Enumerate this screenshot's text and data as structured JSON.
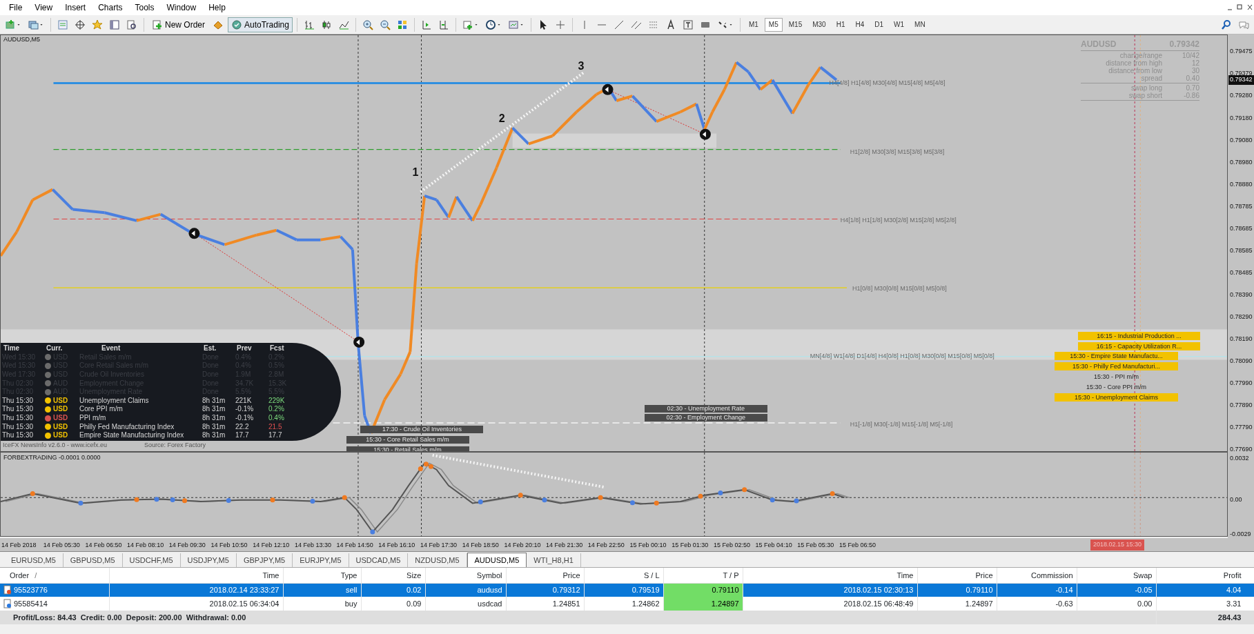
{
  "menu": [
    "File",
    "View",
    "Insert",
    "Charts",
    "Tools",
    "Window",
    "Help"
  ],
  "toolbar": {
    "buttons": [
      {
        "label": "New Order",
        "kind": "order"
      },
      {
        "label": "AutoTrading",
        "kind": "auto",
        "on": true
      }
    ],
    "timeframes": [
      {
        "label": "M1",
        "selected": false
      },
      {
        "label": "M5",
        "selected": true
      },
      {
        "label": "M15",
        "selected": false
      },
      {
        "label": "M30",
        "selected": false
      },
      {
        "label": "H1",
        "selected": false
      },
      {
        "label": "H4",
        "selected": false
      },
      {
        "label": "D1",
        "selected": false
      },
      {
        "label": "W1",
        "selected": false
      },
      {
        "label": "MN",
        "selected": false
      }
    ]
  },
  "chart": {
    "title": "AUDUSD,M5",
    "wave_marks": [
      "1",
      "2",
      "3"
    ],
    "level_labels": [
      "H4[4/8] H1[4/8] M30[4/8] M15[4/8] M5[4/8]",
      "H1[2/8] M30[3/8] M15[3/8] M5[3/8]",
      "H4[1/8] H1[1/8] M30[2/8] M15[2/8] M5[2/8]",
      "H1[0/8] M30[0/8] M15[0/8] M5[0/8]",
      "MN[4/8] W1[4/8] D1[4/8] H4[0/8] H1[0/8] M30[0/8] M15[0/8] M5[0/8]",
      "H1[-1/8] M30[-1/8] M15[-1/8] M5[-1/8]"
    ],
    "event_labels": [
      "17:30 - Crude Oil Inventories",
      "15:30 - Core Retail Sales m/m",
      "15:30 - Retail Sales m/m",
      "02:30 - Unemployment Rate",
      "02:30 - Employment Change"
    ],
    "news_panel": {
      "columns": [
        "Time",
        "Curr.",
        "Event",
        "Est.",
        "Prev",
        "Fcst"
      ],
      "rows": [
        {
          "time": "Wed 15:30",
          "currency": "USD",
          "event": "Retail Sales m/m",
          "est": "Done",
          "prev": "0.4%",
          "forecast": {
            "value": "0.2%",
            "kind": "flat"
          },
          "past": true,
          "color": "#6b6b6b"
        },
        {
          "time": "Wed 15:30",
          "currency": "USD",
          "event": "Core Retail Sales m/m",
          "est": "Done",
          "prev": "0.4%",
          "forecast": {
            "value": "0.5%",
            "kind": "flat"
          },
          "past": true,
          "color": "#6b6b6b"
        },
        {
          "time": "Wed 17:30",
          "currency": "USD",
          "event": "Crude Oil Inventories",
          "est": "Done",
          "prev": "1.9M",
          "forecast": {
            "value": "2.8M",
            "kind": "flat"
          },
          "past": true,
          "color": "#6b6b6b"
        },
        {
          "time": "Thu 02:30",
          "currency": "AUD",
          "event": "Employment Change",
          "est": "Done",
          "prev": "34.7K",
          "forecast": {
            "value": "15.3K",
            "kind": "flat"
          },
          "past": true,
          "color": "#6b6b6b"
        },
        {
          "time": "Thu 02:30",
          "currency": "AUD",
          "event": "Unemployment Rate",
          "est": "Done",
          "prev": "5.5%",
          "forecast": {
            "value": "5.5%",
            "kind": "flat"
          },
          "past": true,
          "color": "#6b6b6b"
        },
        {
          "time": "Thu 15:30",
          "currency": "USD",
          "event": "Unemployment Claims",
          "est": "8h 31m",
          "prev": "221K",
          "forecast": {
            "value": "229K",
            "kind": "up"
          },
          "past": false,
          "color": "#f2c200"
        },
        {
          "time": "Thu 15:30",
          "currency": "USD",
          "event": "Core PPI m/m",
          "est": "8h 31m",
          "prev": "-0.1%",
          "forecast": {
            "value": "0.2%",
            "kind": "up"
          },
          "past": false,
          "color": "#f2c200"
        },
        {
          "time": "Thu 15:30",
          "currency": "USD",
          "event": "PPI m/m",
          "est": "8h 31m",
          "prev": "-0.1%",
          "forecast": {
            "value": "0.4%",
            "kind": "up"
          },
          "past": false,
          "color": "#d9534f"
        },
        {
          "time": "Thu 15:30",
          "currency": "USD",
          "event": "Philly Fed Manufacturing Index",
          "est": "8h 31m",
          "prev": "22.2",
          "forecast": {
            "value": "21.5",
            "kind": "down"
          },
          "past": false,
          "color": "#f2c200"
        },
        {
          "time": "Thu 15:30",
          "currency": "USD",
          "event": "Empire State Manufacturing Index",
          "est": "8h 31m",
          "prev": "17.7",
          "forecast": {
            "value": "17.7",
            "kind": "flat"
          },
          "past": false,
          "color": "#f2c200"
        }
      ],
      "footer": [
        "IceFX NewsInfo v2.6.0  -  www.icefx.eu",
        "Source: Forex Factory"
      ]
    },
    "info_panel": {
      "symbol": "AUDUSD",
      "price": "0.79342",
      "groups": [
        [
          {
            "label": "change/range",
            "value": "10/42"
          },
          {
            "label": "distance from high",
            "value": "12"
          },
          {
            "label": "distance from low",
            "value": "30"
          },
          {
            "label": "spread",
            "value": "0.40"
          }
        ],
        [
          {
            "label": "swap long",
            "value": "0.70"
          },
          {
            "label": "swap short",
            "value": "-0.86"
          }
        ]
      ]
    },
    "upcoming": [
      {
        "text": "16:15 - Industrial Production ...",
        "highlighted": true
      },
      {
        "text": "16:15 - Capacity Utilization R...",
        "highlighted": true
      },
      {
        "text": "15:30 - Empire State Manufactu...",
        "highlighted": true
      },
      {
        "text": "15:30 - Philly Fed Manufacturi...",
        "highlighted": true
      },
      {
        "text": "15:30 - PPI m/m",
        "highlighted": false
      },
      {
        "text": "15:30 - Core PPI m/m",
        "highlighted": false
      },
      {
        "text": "15:30 - Unemployment Claims",
        "highlighted": true
      }
    ],
    "price_axis": {
      "ticks": [
        "0.79475",
        "0.79379",
        "0.79280",
        "0.79180",
        "0.79080",
        "0.78980",
        "0.78880",
        "0.78785",
        "0.78685",
        "0.78585",
        "0.78485",
        "0.78390",
        "0.78290",
        "0.78190",
        "0.78090",
        "0.77990",
        "0.77890",
        "0.77790",
        "0.77690"
      ],
      "current": "0.79342"
    },
    "indicator": {
      "title": "FORBEXTRADING -0.0001 0.0000",
      "axis": [
        "0.0032",
        "0.00",
        "-0.0029"
      ]
    },
    "time_axis": {
      "labels": [
        "14 Feb 2018",
        "14 Feb 05:30",
        "14 Feb 06:50",
        "14 Feb 08:10",
        "14 Feb 09:30",
        "14 Feb 10:50",
        "14 Feb 12:10",
        "14 Feb 13:30",
        "14 Feb 14:50",
        "14 Feb 16:10",
        "14 Feb 17:30",
        "14 Feb 18:50",
        "14 Feb 20:10",
        "14 Feb 21:30",
        "14 Feb 22:50",
        "15 Feb 00:10",
        "15 Feb 01:30",
        "15 Feb 02:50",
        "15 Feb 04:10",
        "15 Feb 05:30",
        "15 Feb 06:50"
      ],
      "cursor": "2018.02.15 15:30"
    }
  },
  "symbol_tabs": [
    {
      "label": "EURUSD,M5",
      "selected": false
    },
    {
      "label": "GBPUSD,M5",
      "selected": false
    },
    {
      "label": "USDCHF,M5",
      "selected": false
    },
    {
      "label": "USDJPY,M5",
      "selected": false
    },
    {
      "label": "GBPJPY,M5",
      "selected": false
    },
    {
      "label": "EURJPY,M5",
      "selected": false
    },
    {
      "label": "USDCAD,M5",
      "selected": false
    },
    {
      "label": "NZDUSD,M5",
      "selected": false
    },
    {
      "label": "AUDUSD,M5",
      "selected": true
    },
    {
      "label": "WTI_H8,H1",
      "selected": false
    }
  ],
  "terminal": {
    "columns": [
      "Order",
      "Time",
      "Type",
      "Size",
      "Symbol",
      "Price",
      "S / L",
      "T / P",
      "Time",
      "Price",
      "Commission",
      "Swap",
      "Profit"
    ],
    "sort_mark": "/",
    "rows": [
      {
        "kind": "sell",
        "selected": true,
        "cells": [
          "95523776",
          "2018.02.14 23:33:27",
          "sell",
          "0.02",
          "audusd",
          "0.79312",
          "0.79519",
          "0.79110",
          "2018.02.15 02:30:13",
          "0.79110",
          "-0.14",
          "-0.05",
          "4.04"
        ]
      },
      {
        "kind": "buy",
        "selected": false,
        "cells": [
          "95585414",
          "2018.02.15 06:34:04",
          "buy",
          "0.09",
          "usdcad",
          "1.24851",
          "1.24862",
          "1.24897",
          "2018.02.15 06:48:49",
          "1.24897",
          "-0.63",
          "0.00",
          "3.31"
        ]
      }
    ],
    "summary": "Profit/Loss: 84.43  Credit: 0.00  Deposit: 200.00  Withdrawal: 0.00",
    "total": "284.43"
  }
}
